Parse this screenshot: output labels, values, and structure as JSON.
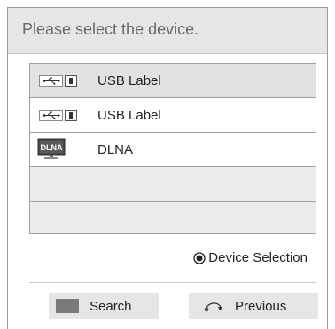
{
  "dialog": {
    "title": "Please select the device."
  },
  "devices": [
    {
      "icon": "usb-icon",
      "label": "USB Label",
      "selected": true
    },
    {
      "icon": "usb-icon",
      "label": "USB Label",
      "selected": false
    },
    {
      "icon": "dlna-icon",
      "label": "DLNA",
      "icon_text": "DLNA",
      "selected": false
    }
  ],
  "hint": {
    "icon": "radio-selected-icon",
    "label": "Device Selection"
  },
  "buttons": {
    "search": {
      "icon": "gray-key-icon",
      "label": "Search"
    },
    "previous": {
      "icon": "back-arrow-icon",
      "label": "Previous"
    }
  }
}
